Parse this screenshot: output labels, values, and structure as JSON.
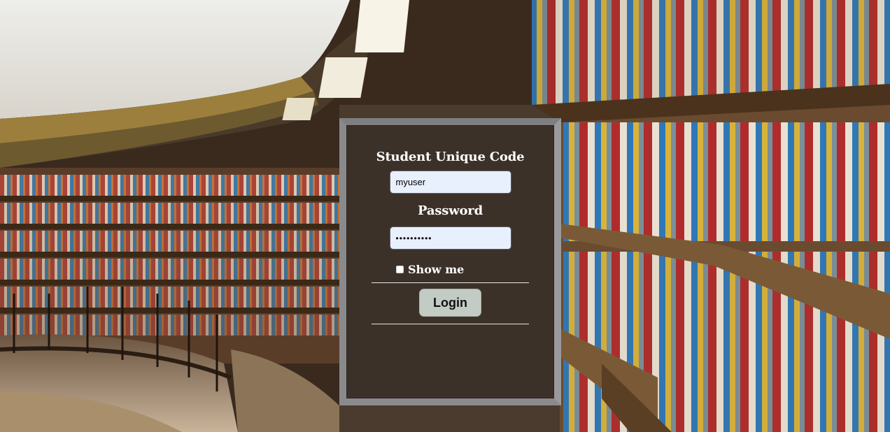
{
  "form": {
    "code_label": "Student Unique Code",
    "code_value": "myuser",
    "password_label": "Password",
    "password_value": "••••••••••",
    "show_label": "Show me",
    "show_checked": false,
    "login_label": "Login"
  },
  "colors": {
    "input_bg": "#e8f0fe",
    "button_bg": "#c3ccc4",
    "panel_border": "#8d8d8f"
  }
}
